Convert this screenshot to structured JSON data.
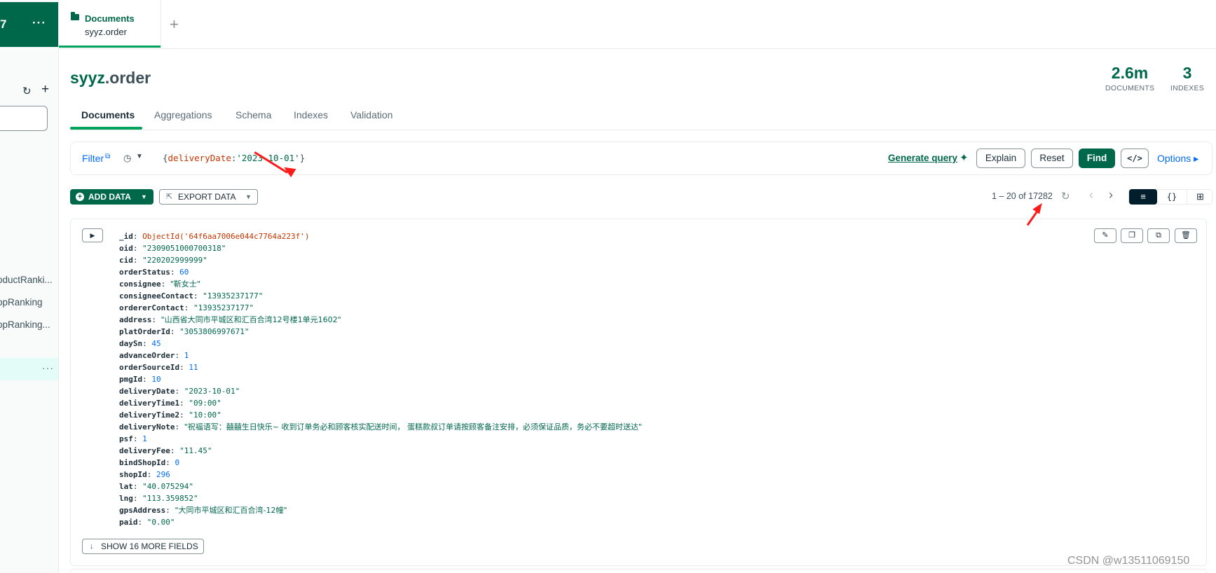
{
  "sidebar": {
    "connection_label": "7",
    "connection_more": "···",
    "refresh_icon": "↻",
    "add_icon": "+",
    "items": [
      {
        "label": "oductRanki..."
      },
      {
        "label": "opRanking"
      },
      {
        "label": "opRanking..."
      }
    ],
    "active_more": "···"
  },
  "tabs": {
    "active": {
      "title": "Documents",
      "subtitle": "syyz.order"
    },
    "add_icon": "+"
  },
  "header": {
    "db": "syyz",
    "collection": ".order",
    "documents_count": "2.6m",
    "documents_label": "DOCUMENTS",
    "indexes_count": "3",
    "indexes_label": "INDEXES"
  },
  "subtabs": [
    "Documents",
    "Aggregations",
    "Schema",
    "Indexes",
    "Validation"
  ],
  "query": {
    "filter_label": "Filter",
    "filter_key": "deliveryDate",
    "filter_value": "'2023-10-01'",
    "open_brace": "{",
    "close_brace": "}",
    "colon": ":",
    "generate_query": "Generate query",
    "explain": "Explain",
    "reset": "Reset",
    "find": "Find",
    "code": "</>",
    "options": "Options ▸"
  },
  "toolbar": {
    "add_data": "ADD DATA",
    "export_data": "EXPORT DATA",
    "pagination": "1 – 20 of 17282"
  },
  "document": {
    "fields": [
      {
        "key": "_id",
        "value": "ObjectId('64f6aa7006e044c7764a223f')",
        "type": "oid"
      },
      {
        "key": "oid",
        "value": "\"2309051000700318\"",
        "type": "str"
      },
      {
        "key": "cid",
        "value": "\"220202999999\"",
        "type": "str"
      },
      {
        "key": "orderStatus",
        "value": "60",
        "type": "num"
      },
      {
        "key": "consignee",
        "value": "\"靳女士\"",
        "type": "cn"
      },
      {
        "key": "consigneeContact",
        "value": "\"13935237177\"",
        "type": "str"
      },
      {
        "key": "ordererContact",
        "value": "\"13935237177\"",
        "type": "str"
      },
      {
        "key": "address",
        "value": "\"山西省大同市平城区和汇百合湾12号楼1单元1602\"",
        "type": "cn"
      },
      {
        "key": "platOrderId",
        "value": "\"3053806997671\"",
        "type": "str"
      },
      {
        "key": "daySn",
        "value": "45",
        "type": "num"
      },
      {
        "key": "advanceOrder",
        "value": "1",
        "type": "num"
      },
      {
        "key": "orderSourceId",
        "value": "11",
        "type": "num"
      },
      {
        "key": "pmgId",
        "value": "10",
        "type": "num"
      },
      {
        "key": "deliveryDate",
        "value": "\"2023-10-01\"",
        "type": "str"
      },
      {
        "key": "deliveryTime1",
        "value": "\"09:00\"",
        "type": "str"
      },
      {
        "key": "deliveryTime2",
        "value": "\"10:00\"",
        "type": "str"
      },
      {
        "key": "deliveryNote",
        "value": "\"祝福语写：囍囍生日快乐~   收到订单务必和顾客核实配送时间， 蛋糕款叔订单请按顾客备注安排，必须保证品质，务必不要超时送达\"",
        "type": "cn"
      },
      {
        "key": "psf",
        "value": "1",
        "type": "num"
      },
      {
        "key": "deliveryFee",
        "value": "\"11.45\"",
        "type": "str"
      },
      {
        "key": "bindShopId",
        "value": "0",
        "type": "num"
      },
      {
        "key": "shopId",
        "value": "296",
        "type": "num"
      },
      {
        "key": "lat",
        "value": "\"40.075294\"",
        "type": "str"
      },
      {
        "key": "lng",
        "value": "\"113.359852\"",
        "type": "str"
      },
      {
        "key": "gpsAddress",
        "value": "\"大同市平城区和汇百合湾-12幢\"",
        "type": "cn"
      },
      {
        "key": "paid",
        "value": "\"0.00\"",
        "type": "str"
      }
    ],
    "show_more": "SHOW 16 MORE FIELDS"
  },
  "watermark": "CSDN @w13511069150",
  "colors": {
    "brand": "#00684a",
    "accent_green": "#00a35c",
    "link_blue": "#016bf8",
    "annotation_red": "#ff1a1a"
  }
}
